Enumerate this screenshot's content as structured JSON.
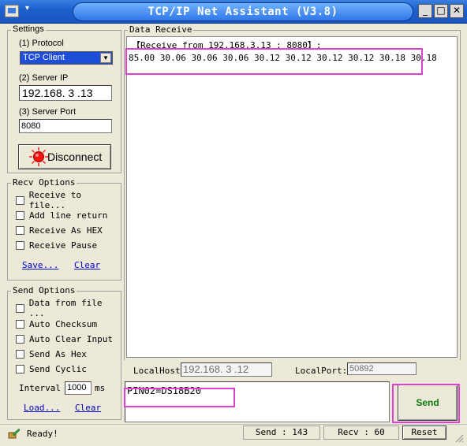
{
  "window": {
    "title": "TCP/IP Net Assistant (V3.8)",
    "app_icon": "network-app-icon",
    "menu_arrow": "▾",
    "controls": {
      "minimize": "_",
      "maximize": "□",
      "close": "✕"
    }
  },
  "settings": {
    "title": "Settings",
    "protocol_label": "(1) Protocol",
    "protocol_value": "TCP Client",
    "server_ip_label": "(2) Server IP",
    "server_ip_value": "192.168. 3 .13",
    "server_port_label": "(3) Server Port",
    "server_port_value": "8080",
    "disconnect_label": "Disconnect"
  },
  "recv_options": {
    "title": "Recv Options",
    "items": [
      "Receive to file...",
      "Add line return",
      "Receive As HEX",
      "Receive Pause"
    ],
    "save_label": "Save...",
    "clear_label": "Clear"
  },
  "send_options": {
    "title": "Send Options",
    "items": [
      "Data from file ...",
      "Auto Checksum",
      "Auto Clear Input",
      "Send As Hex",
      "Send Cyclic"
    ],
    "interval_label": "Interval",
    "interval_value": "1000",
    "interval_unit": "ms",
    "load_label": "Load...",
    "clear_label": "Clear"
  },
  "data_receive": {
    "title": "Data Receive",
    "header": "【Receive from 192.168.3.13 : 8080】:",
    "data": "85.00 30.06 30.06 30.06 30.12 30.12 30.12 30.12 30.18 30.18"
  },
  "local": {
    "host_label": "LocalHost:",
    "host_value": "192.168. 3 .12",
    "port_label": "LocalPort:",
    "port_value": "50892"
  },
  "send": {
    "input_value": "PIN02=DS18B20",
    "button_label": "Send"
  },
  "status": {
    "ready": "Ready!",
    "send_count": "Send : 143",
    "recv_count": "Recv : 60",
    "reset_label": "Reset"
  },
  "colors": {
    "highlight": "#e040d0",
    "send_label": "#0a7a0a",
    "link": "#0000cc"
  }
}
